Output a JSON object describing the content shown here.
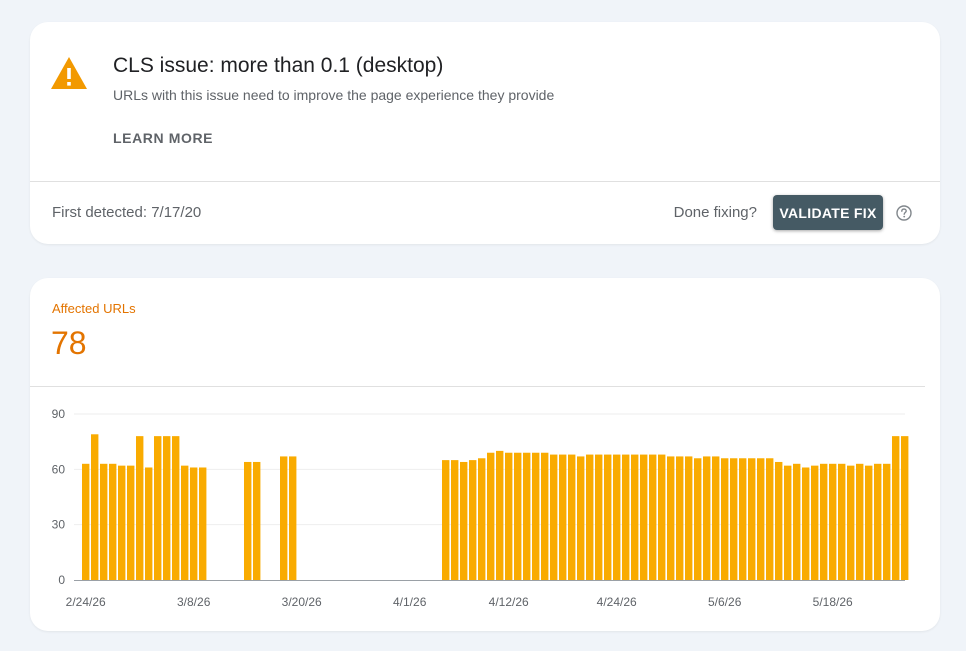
{
  "issue": {
    "title": "CLS issue: more than 0.1 (desktop)",
    "subtitle": "URLs with this issue need to improve the page experience they provide",
    "learn_more": "LEARN MORE",
    "first_detected": "First detected: 7/17/20",
    "done_fixing": "Done fixing?",
    "validate_fix": "VALIDATE FIX",
    "warning_color": "#f29900",
    "button_color": "#455a64",
    "icons": [
      "warning-icon",
      "help-icon"
    ]
  },
  "affected": {
    "label": "Affected URLs",
    "count": "78",
    "accent_color": "#e37400"
  },
  "chart_data": {
    "type": "bar",
    "color": "#f9ab00",
    "ylim": [
      0,
      90
    ],
    "y_ticks": [
      "90",
      "60",
      "30",
      "0"
    ],
    "y_tick_values": [
      90,
      60,
      30,
      0
    ],
    "x_tick_labels": [
      "2/24/26",
      "3/8/26",
      "3/20/26",
      "4/1/26",
      "4/12/26",
      "4/24/26",
      "5/6/26",
      "5/18/26"
    ],
    "x_tick_indices": [
      0,
      12,
      24,
      36,
      47,
      59,
      71,
      83
    ],
    "grid": true,
    "legend": "none",
    "values": [
      63,
      79,
      63,
      63,
      62,
      62,
      78,
      61,
      78,
      78,
      78,
      62,
      61,
      61,
      0,
      0,
      0,
      0,
      64,
      64,
      0,
      0,
      67,
      67,
      0,
      0,
      0,
      0,
      0,
      0,
      0,
      0,
      0,
      0,
      0,
      0,
      0,
      0,
      0,
      0,
      65,
      65,
      64,
      65,
      66,
      69,
      70,
      69,
      69,
      69,
      69,
      69,
      68,
      68,
      68,
      67,
      68,
      68,
      68,
      68,
      68,
      68,
      68,
      68,
      68,
      67,
      67,
      67,
      66,
      67,
      67,
      66,
      66,
      66,
      66,
      66,
      66,
      64,
      62,
      63,
      61,
      62,
      63,
      63,
      63,
      62,
      63,
      62,
      63,
      63,
      78,
      78
    ]
  }
}
